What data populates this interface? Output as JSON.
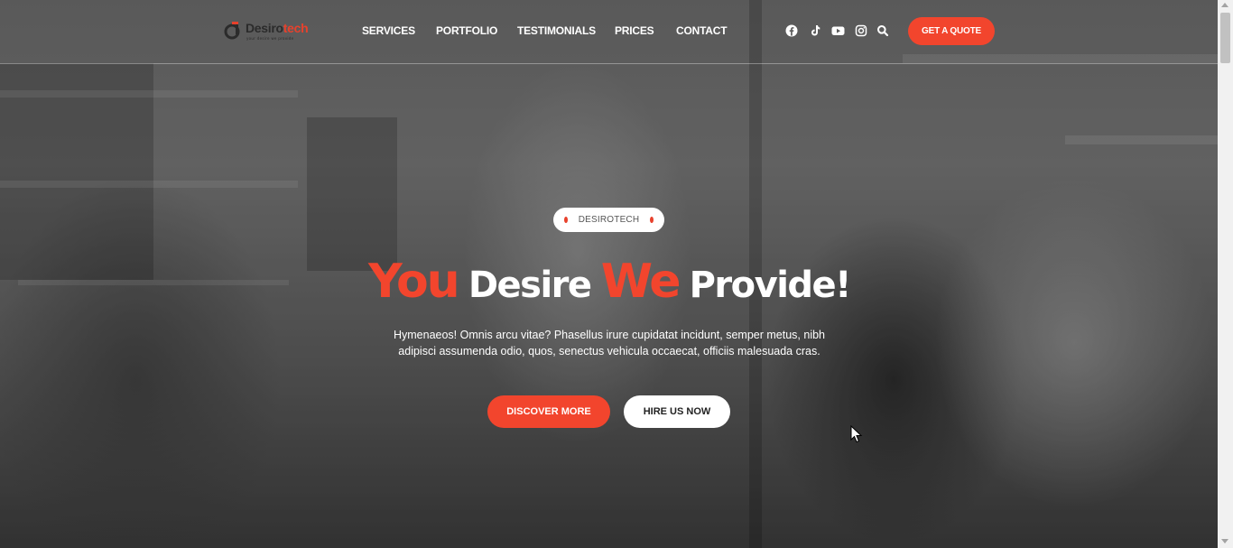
{
  "logo": {
    "name_part1": "Desiro",
    "name_part2": "tech",
    "tagline": "your desire we provide"
  },
  "nav": {
    "items": [
      {
        "label": "SERVICES"
      },
      {
        "label": "PORTFOLIO"
      },
      {
        "label": "TESTIMONIALS"
      },
      {
        "label": "PRICES"
      },
      {
        "label": "CONTACT"
      }
    ]
  },
  "social_icons": [
    "facebook-icon",
    "tiktok-icon",
    "youtube-icon",
    "instagram-icon",
    "search-icon"
  ],
  "header_cta": {
    "label": "GET A QUOTE"
  },
  "hero": {
    "badge": "DESIROTECH",
    "headline": {
      "word1": "You",
      "word2": "Desire",
      "word3": "We",
      "word4": "Provide!"
    },
    "description": "Hymenaeos! Omnis arcu vitae? Phasellus irure cupidatat incidunt, semper metus, nibh adipisci assumenda odio, quos, senectus vehicula occaecat, officiis malesuada cras.",
    "primary_button": "DISCOVER MORE",
    "secondary_button": "HIRE US NOW"
  },
  "colors": {
    "accent": "#f2452d",
    "white": "#ffffff",
    "dark": "#2b2b2b"
  }
}
